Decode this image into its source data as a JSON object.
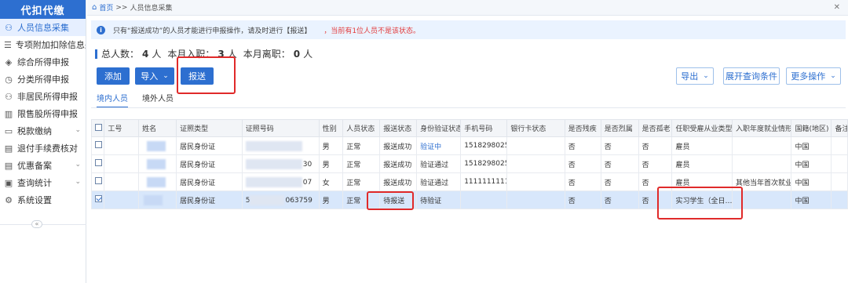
{
  "app": {
    "logo": "代扣代缴"
  },
  "sidebar": {
    "items": [
      {
        "label": "人员信息采集",
        "icon": "person-icon",
        "active": true,
        "arrow": ""
      },
      {
        "label": "专项附加扣除信息采集",
        "icon": "list-icon",
        "active": false,
        "arrow": ""
      },
      {
        "label": "综合所得申报",
        "icon": "layers-icon",
        "active": false,
        "arrow": ""
      },
      {
        "label": "分类所得申报",
        "icon": "clock-icon",
        "active": false,
        "arrow": ""
      },
      {
        "label": "非居民所得申报",
        "icon": "person-icon",
        "active": false,
        "arrow": ""
      },
      {
        "label": "限售股所得申报",
        "icon": "bar-chart-icon",
        "active": false,
        "arrow": ""
      },
      {
        "label": "税款缴纳",
        "icon": "folder-icon",
        "active": false,
        "arrow": "⌄"
      },
      {
        "label": "退付手续费核对",
        "icon": "document-icon",
        "active": false,
        "arrow": ""
      },
      {
        "label": "优惠备案",
        "icon": "document-icon",
        "active": false,
        "arrow": "⌄"
      },
      {
        "label": "查询统计",
        "icon": "computer-icon",
        "active": false,
        "arrow": "⌄"
      },
      {
        "label": "系统设置",
        "icon": "gear-icon",
        "active": false,
        "arrow": ""
      }
    ],
    "collapse": "«"
  },
  "breadcrumb": {
    "home": "首页",
    "sep": ">>",
    "current": "人员信息采集",
    "close": "✕"
  },
  "notice": {
    "text": "只有“报送成功”的人员才能进行申报操作，请及时进行【报送】",
    "warning": "，当前有1位人员不是该状态。"
  },
  "stats": {
    "total_label": "总人数：",
    "total": "4",
    "total_unit": "人",
    "hired_label": "本月入职：",
    "hired": "3",
    "hired_unit": "人",
    "left_label": "本月离职：",
    "left": "0",
    "left_unit": "人"
  },
  "toolbar": {
    "add": "添加",
    "import": "导入",
    "submit": "报送",
    "export": "导出",
    "expand_query": "展开查询条件",
    "more": "更多操作"
  },
  "tabs": [
    {
      "label": "境内人员",
      "active": true
    },
    {
      "label": "境外人员",
      "active": false
    }
  ],
  "table": {
    "headers": [
      "工号",
      "姓名",
      "证照类型",
      "证照号码",
      "性别",
      "人员状态",
      "报送状态",
      "身份验证状态",
      "手机号码",
      "银行卡状态",
      "是否残疾",
      "是否烈属",
      "是否孤老",
      "任职受雇从业类型",
      "入职年度就业情形",
      "国籍(地区)",
      "备注"
    ],
    "rows": [
      {
        "checked": false,
        "id_type": "居民身份证",
        "id_tail": "",
        "gender": "男",
        "status": "正常",
        "submit": "报送成功",
        "verify": "验证中",
        "verify_link": true,
        "phone": "15182980259",
        "bank": "",
        "disabled": "否",
        "martyr": "否",
        "elder": "否",
        "employ": "雇员",
        "year_emp": "",
        "nation": "中国",
        "remark": ""
      },
      {
        "checked": false,
        "id_type": "居民身份证",
        "id_tail": "30",
        "gender": "男",
        "status": "正常",
        "submit": "报送成功",
        "verify": "验证通过",
        "verify_link": false,
        "phone": "15182980259",
        "bank": "",
        "disabled": "否",
        "martyr": "否",
        "elder": "否",
        "employ": "雇员",
        "year_emp": "",
        "nation": "中国",
        "remark": ""
      },
      {
        "checked": false,
        "id_type": "居民身份证",
        "id_tail": "07",
        "gender": "女",
        "status": "正常",
        "submit": "报送成功",
        "verify": "验证通过",
        "verify_link": false,
        "phone": "11111111111",
        "bank": "",
        "disabled": "否",
        "martyr": "否",
        "elder": "否",
        "employ": "雇员",
        "year_emp": "其他当年首次就业",
        "nation": "中国",
        "remark": ""
      },
      {
        "checked": true,
        "id_type": "居民身份证",
        "id_head": "5",
        "id_tail": "063759",
        "gender": "男",
        "status": "正常",
        "submit": "待报送",
        "verify": "待验证",
        "verify_link": false,
        "phone": "",
        "bank": "",
        "disabled": "否",
        "martyr": "否",
        "elder": "否",
        "employ": "实习学生（全日…",
        "year_emp": "",
        "nation": "中国",
        "remark": ""
      }
    ]
  },
  "colors": {
    "primary": "#2d6fd0",
    "highlight": "#e02a2a",
    "selected_row": "#d8e7fb"
  }
}
